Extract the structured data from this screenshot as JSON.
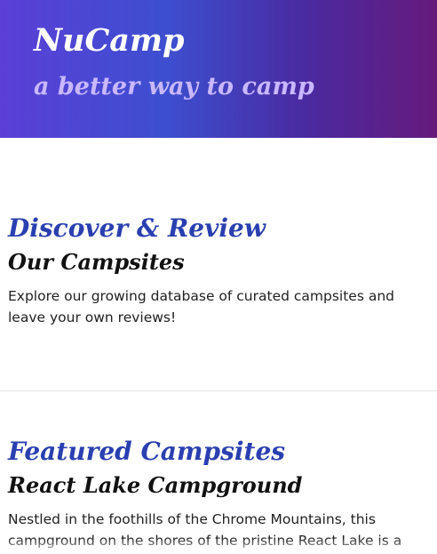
{
  "header": {
    "title": "NuCamp",
    "tagline": "a better way to camp"
  },
  "discover_section": {
    "heading": "Discover & Review",
    "subheading": "Our Campsites",
    "text": "Explore our growing database of curated campsites and leave your own reviews!"
  },
  "featured_section": {
    "heading": "Featured Campsites",
    "subheading": "React Lake Campground",
    "text": "Nestled in the foothills of the Chrome Mountains, this campground on the shores of the pristine React Lake is a"
  },
  "colors": {
    "header_gradient_start": "#5b3fd6",
    "header_gradient_end": "#661a7c",
    "heading_blue": "#2a3fb0",
    "tagline_lavender": "#c9b8ff"
  }
}
